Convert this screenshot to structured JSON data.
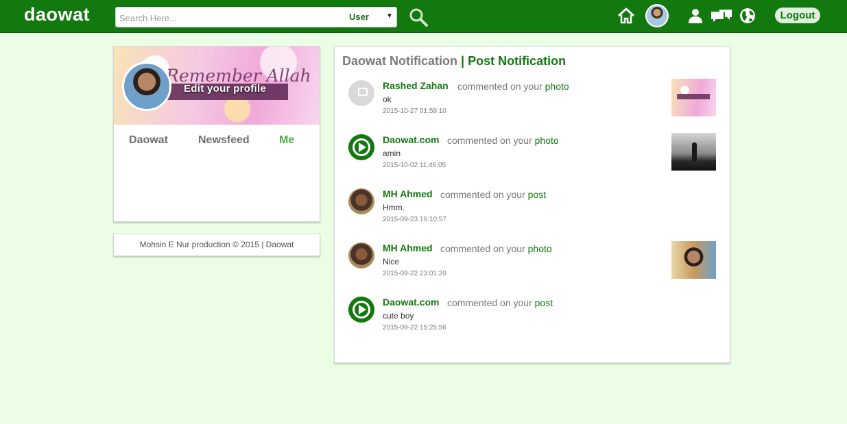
{
  "header": {
    "brand": "daowat",
    "search": {
      "placeholder": "Search Here...",
      "type_value": "User"
    },
    "icons": [
      "search-icon",
      "home-icon",
      "avatar",
      "user-icon",
      "messages-icon",
      "globe-icon"
    ],
    "logout_label": "Logout"
  },
  "profile": {
    "edit_label": "Edit your profile",
    "tabs": [
      {
        "label": "Daowat"
      },
      {
        "label": "Newsfeed"
      },
      {
        "label": "Me"
      }
    ],
    "active_tab": "Me"
  },
  "footer": {
    "text": "Mohsin E Nur production © 2015 | Daowat"
  },
  "notifications": {
    "title_main": "Daowat Notification",
    "title_sep_sub": "| Post Notification",
    "items": [
      {
        "name": "Rashed Zahan",
        "action": "commented on your",
        "target": "photo",
        "message": "ok",
        "time": "2015-10-27 01:59:10",
        "avatar": "no-photo"
      },
      {
        "name": "Daowat.com",
        "action": "commented on your",
        "target": "photo",
        "message": "amin",
        "time": "2015-10-02 11:46:05",
        "avatar": "daowat-logo"
      },
      {
        "name": "MH Ahmed",
        "action": "commented on your",
        "target": "post",
        "message": "Hmm.",
        "time": "2015-09-23 16:10:57",
        "avatar": "user-photo"
      },
      {
        "name": "MH Ahmed",
        "action": "commented on your",
        "target": "photo",
        "message": "Nice",
        "time": "2015-09-22 23:01:20",
        "avatar": "user-photo"
      },
      {
        "name": "Daowat.com",
        "action": "commented on your",
        "target": "post",
        "message": "cute boy",
        "time": "2015-09-22 15:25:56",
        "avatar": "daowat-logo"
      }
    ]
  },
  "colors": {
    "brand_green": "#12790f",
    "page_bg": "#ecfde6",
    "active_tab": "#46b046"
  }
}
